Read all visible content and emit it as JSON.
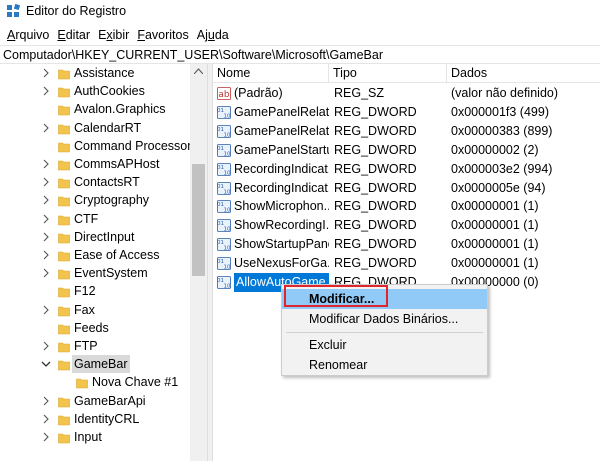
{
  "window": {
    "title": "Editor do Registro"
  },
  "menubar": [
    {
      "pre": "",
      "key": "A",
      "post": "rquivo"
    },
    {
      "pre": "",
      "key": "E",
      "post": "ditar"
    },
    {
      "pre": "E",
      "key": "x",
      "post": "ibir"
    },
    {
      "pre": "",
      "key": "F",
      "post": "avoritos"
    },
    {
      "pre": "Aj",
      "key": "u",
      "post": "da"
    }
  ],
  "address": "Computador\\HKEY_CURRENT_USER\\Software\\Microsoft\\GameBar",
  "tree": [
    {
      "label": "Assistance",
      "expandable": true,
      "expanded": false,
      "level": 0
    },
    {
      "label": "AuthCookies",
      "expandable": true,
      "expanded": false,
      "level": 0
    },
    {
      "label": "Avalon.Graphics",
      "expandable": false,
      "expanded": false,
      "level": 0
    },
    {
      "label": "CalendarRT",
      "expandable": true,
      "expanded": false,
      "level": 0
    },
    {
      "label": "Command Processor",
      "expandable": false,
      "expanded": false,
      "level": 0
    },
    {
      "label": "CommsAPHost",
      "expandable": true,
      "expanded": false,
      "level": 0
    },
    {
      "label": "ContactsRT",
      "expandable": true,
      "expanded": false,
      "level": 0
    },
    {
      "label": "Cryptography",
      "expandable": true,
      "expanded": false,
      "level": 0
    },
    {
      "label": "CTF",
      "expandable": true,
      "expanded": false,
      "level": 0
    },
    {
      "label": "DirectInput",
      "expandable": true,
      "expanded": false,
      "level": 0
    },
    {
      "label": "Ease of Access",
      "expandable": true,
      "expanded": false,
      "level": 0
    },
    {
      "label": "EventSystem",
      "expandable": true,
      "expanded": false,
      "level": 0
    },
    {
      "label": "F12",
      "expandable": false,
      "expanded": false,
      "level": 0
    },
    {
      "label": "Fax",
      "expandable": true,
      "expanded": false,
      "level": 0
    },
    {
      "label": "Feeds",
      "expandable": false,
      "expanded": false,
      "level": 0
    },
    {
      "label": "FTP",
      "expandable": true,
      "expanded": false,
      "level": 0
    },
    {
      "label": "GameBar",
      "expandable": true,
      "expanded": true,
      "level": 0,
      "selected": true
    },
    {
      "label": "Nova Chave #1",
      "expandable": false,
      "expanded": false,
      "level": 1
    },
    {
      "label": "GameBarApi",
      "expandable": true,
      "expanded": false,
      "level": 0
    },
    {
      "label": "IdentityCRL",
      "expandable": true,
      "expanded": false,
      "level": 0
    },
    {
      "label": "Input",
      "expandable": true,
      "expanded": false,
      "level": 0
    }
  ],
  "list": {
    "headers": {
      "name": "Nome",
      "type": "Tipo",
      "data": "Dados"
    },
    "rows": [
      {
        "name": "(Padrão)",
        "type": "REG_SZ",
        "data": "(valor não definido)",
        "icon": "string-value-icon"
      },
      {
        "name": "GamePanelRelati...",
        "type": "REG_DWORD",
        "data": "0x000001f3 (499)",
        "icon": "binary-value-icon"
      },
      {
        "name": "GamePanelRelati...",
        "type": "REG_DWORD",
        "data": "0x00000383 (899)",
        "icon": "binary-value-icon"
      },
      {
        "name": "GamePanelStartu...",
        "type": "REG_DWORD",
        "data": "0x00000002 (2)",
        "icon": "binary-value-icon"
      },
      {
        "name": "RecordingIndicat...",
        "type": "REG_DWORD",
        "data": "0x000003e2 (994)",
        "icon": "binary-value-icon"
      },
      {
        "name": "RecordingIndicat...",
        "type": "REG_DWORD",
        "data": "0x0000005e (94)",
        "icon": "binary-value-icon"
      },
      {
        "name": "ShowMicrophon...",
        "type": "REG_DWORD",
        "data": "0x00000001 (1)",
        "icon": "binary-value-icon"
      },
      {
        "name": "ShowRecordingI...",
        "type": "REG_DWORD",
        "data": "0x00000001 (1)",
        "icon": "binary-value-icon"
      },
      {
        "name": "ShowStartupPanel",
        "type": "REG_DWORD",
        "data": "0x00000001 (1)",
        "icon": "binary-value-icon"
      },
      {
        "name": "UseNexusForGa...",
        "type": "REG_DWORD",
        "data": "0x00000001 (1)",
        "icon": "binary-value-icon"
      },
      {
        "name": "AllowAutoGame...",
        "type": "REG_DWORD",
        "data": "0x00000000 (0)",
        "icon": "binary-value-icon",
        "highlight": true
      }
    ]
  },
  "context_menu": {
    "items": [
      {
        "label": "Modificar...",
        "bold": true,
        "hover": true
      },
      {
        "label": "Modificar Dados Binários...",
        "bold": false,
        "hover": false
      },
      {
        "label": "Excluir",
        "bold": false,
        "hover": false
      },
      {
        "label": "Renomear",
        "bold": false,
        "hover": false
      }
    ]
  },
  "colors": {
    "selection": "#0078d7",
    "menu_hover": "#91c9f7",
    "callout": "#e0262d",
    "folder": "#f3c44d"
  }
}
